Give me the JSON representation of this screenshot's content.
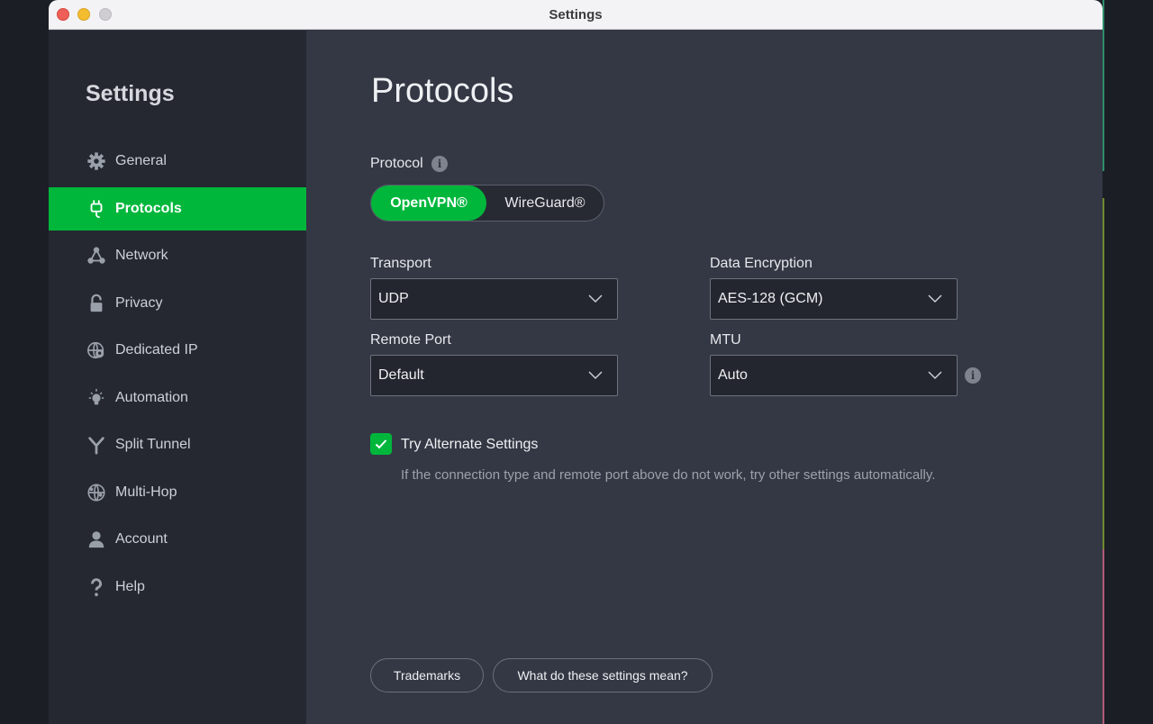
{
  "window": {
    "title": "Settings"
  },
  "sidebar": {
    "title": "Settings",
    "items": [
      {
        "label": "General",
        "icon": "gear-icon",
        "active": false
      },
      {
        "label": "Protocols",
        "icon": "plug-icon",
        "active": true
      },
      {
        "label": "Network",
        "icon": "network-icon",
        "active": false
      },
      {
        "label": "Privacy",
        "icon": "lock-icon",
        "active": false
      },
      {
        "label": "Dedicated IP",
        "icon": "globe-pin-icon",
        "active": false
      },
      {
        "label": "Automation",
        "icon": "lightbulb-icon",
        "active": false
      },
      {
        "label": "Split Tunnel",
        "icon": "split-icon",
        "active": false
      },
      {
        "label": "Multi-Hop",
        "icon": "multihop-globe-icon",
        "active": false
      },
      {
        "label": "Account",
        "icon": "person-icon",
        "active": false
      },
      {
        "label": "Help",
        "icon": "question-icon",
        "active": false
      }
    ]
  },
  "main": {
    "title": "Protocols",
    "protocol": {
      "label": "Protocol",
      "options": [
        "OpenVPN®",
        "WireGuard®"
      ],
      "selected": "OpenVPN®"
    },
    "transport": {
      "label": "Transport",
      "value": "UDP"
    },
    "data_encryption": {
      "label": "Data Encryption",
      "value": "AES-128 (GCM)"
    },
    "remote_port": {
      "label": "Remote Port",
      "value": "Default"
    },
    "mtu": {
      "label": "MTU",
      "value": "Auto"
    },
    "alternate": {
      "label": "Try Alternate Settings",
      "checked": true,
      "help": "If the connection type and remote port above do not work, try other settings automatically."
    },
    "buttons": {
      "trademarks": "Trademarks",
      "explain": "What do these settings mean?"
    }
  },
  "colors": {
    "accent": "#00b73c",
    "sidebar_bg": "#252831",
    "content_bg": "#343844"
  }
}
